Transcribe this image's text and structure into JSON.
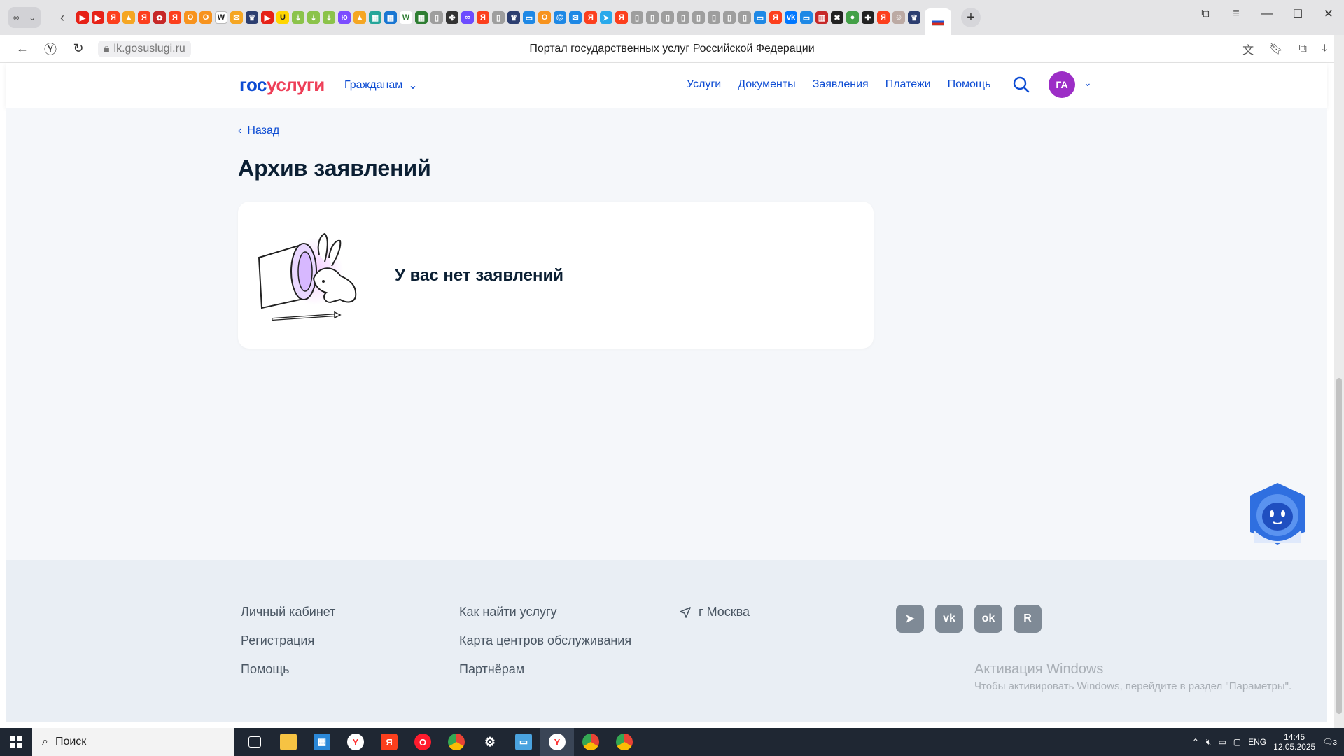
{
  "browser": {
    "url": "lk.gosuslugi.ru",
    "page_title": "Портал государственных услуг Российской Федерации"
  },
  "header": {
    "logo_part1": "гос",
    "logo_part2": "услуги",
    "citizens_label": "Гражданам",
    "nav": [
      "Услуги",
      "Документы",
      "Заявления",
      "Платежи",
      "Помощь"
    ],
    "avatar_initials": "ГА"
  },
  "main": {
    "back_label": "Назад",
    "title": "Архив заявлений",
    "empty_message": "У вас нет заявлений"
  },
  "footer": {
    "col1": [
      "Личный кабинет",
      "Регистрация",
      "Помощь"
    ],
    "col2": [
      "Как найти услугу",
      "Карта центров обслуживания",
      "Партнёрам"
    ],
    "location": "г Москва",
    "socials": [
      "telegram-icon",
      "vk-icon",
      "ok-icon",
      "rutube-icon"
    ]
  },
  "activation": {
    "title": "Активация Windows",
    "subtitle": "Чтобы активировать Windows, перейдите в раздел \"Параметры\"."
  },
  "taskbar": {
    "search_placeholder": "Поиск",
    "lang": "ENG",
    "time": "14:45",
    "date": "12.05.2025",
    "notifications": "3"
  },
  "colors": {
    "brand_blue": "#0d4cd3",
    "brand_red": "#ee3f58",
    "avatar": "#9c2ec6",
    "page_bg": "#f5f7fa",
    "footer_bg": "#e9eef4"
  }
}
